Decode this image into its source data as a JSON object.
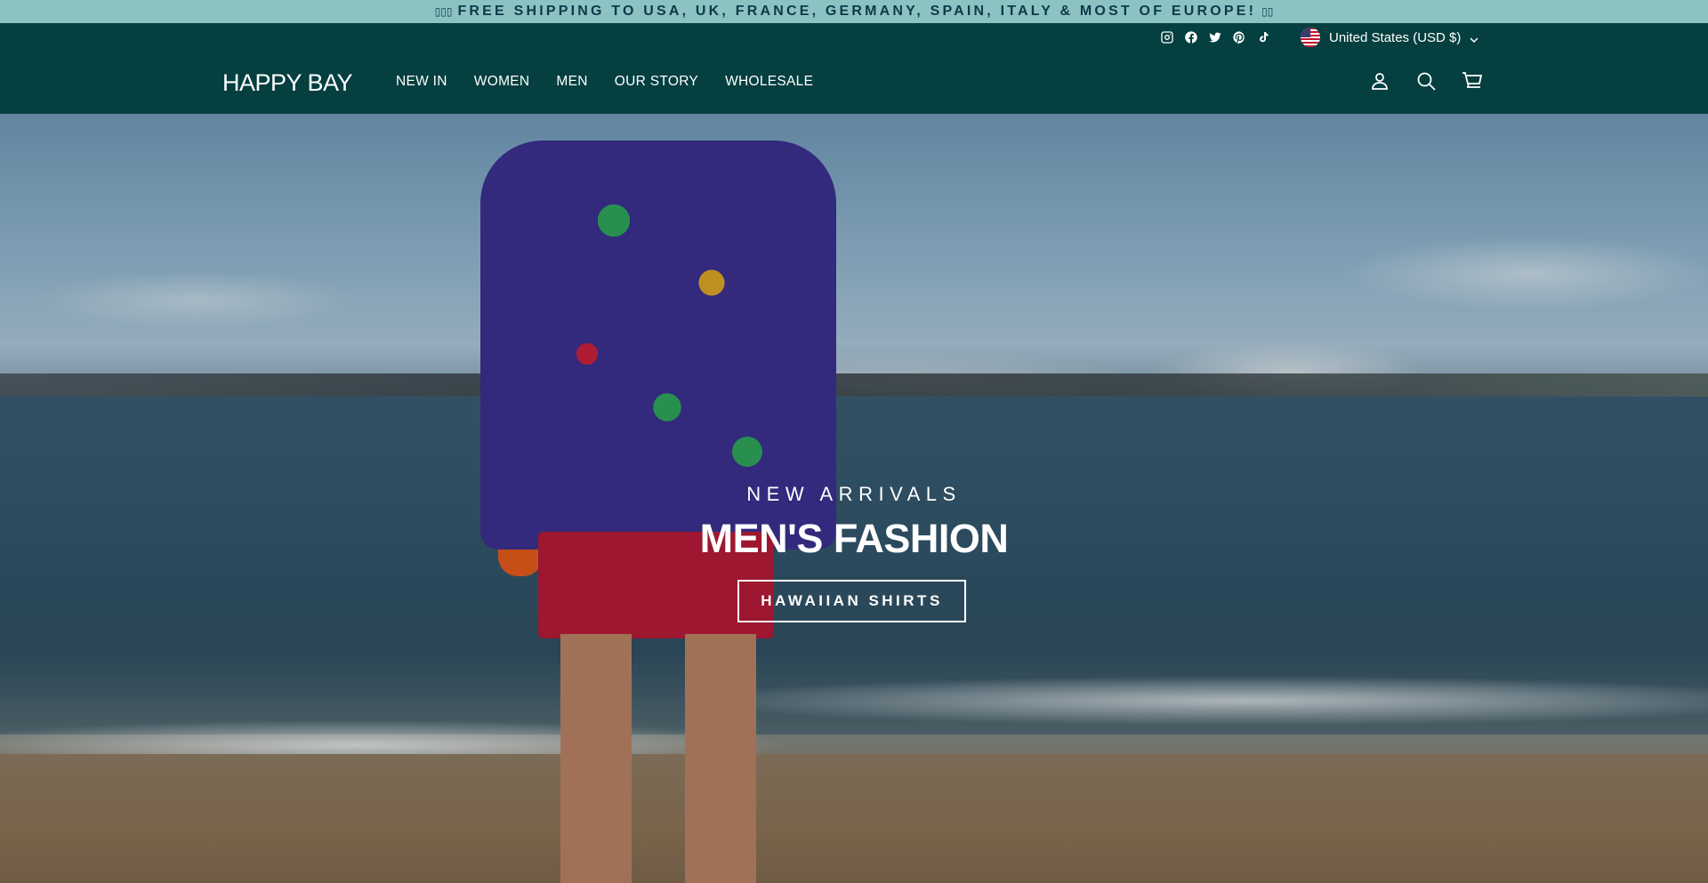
{
  "announcement": {
    "text": "FREE SHIPPING TO USA, UK, FRANCE, GERMANY, SPAIN, ITALY & MOST OF EUROPE!",
    "lead_glyph": "▯▯▯",
    "trail_glyph": "▯▯"
  },
  "utility": {
    "social": [
      "instagram-icon",
      "facebook-icon",
      "twitter-icon",
      "pinterest-icon",
      "tiktok-icon"
    ],
    "currency_label": "United States (USD $)"
  },
  "header": {
    "logo": "HAPPY BAY",
    "nav": [
      "NEW IN",
      "WOMEN",
      "MEN",
      "OUR STORY",
      "WHOLESALE"
    ],
    "icons": [
      "account-icon",
      "search-icon",
      "cart-icon"
    ]
  },
  "hero": {
    "kicker": "NEW ARRIVALS",
    "headline": "MEN'S FASHION",
    "cta": "HAWAIIAN SHIRTS"
  },
  "colors": {
    "announcement_bg": "#8cc3c2",
    "header_bg": "#053f3f",
    "text_light": "#ffffff"
  }
}
